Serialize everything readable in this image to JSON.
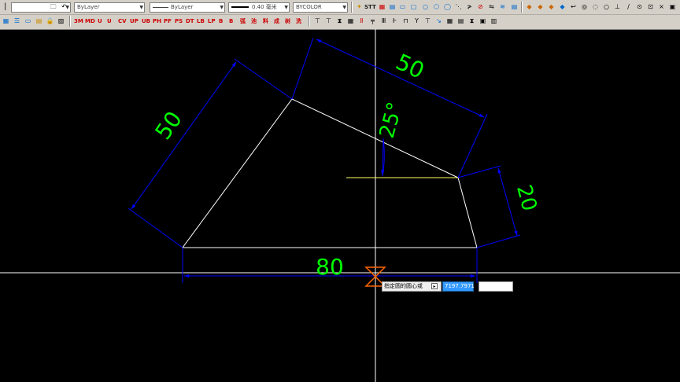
{
  "toolbar": {
    "layer_combo": "ByLayer",
    "linetype_combo": "ByLayer",
    "lineweight_combo": "0.40 毫米",
    "color_combo": "BYCOLOR",
    "row1_right_tools": [
      "STT"
    ],
    "row2_tools": [
      "3M",
      "MD",
      "U",
      "U",
      "CV",
      "UP",
      "UB",
      "PH",
      "PF",
      "PS",
      "DT",
      "LB",
      "LP",
      "B",
      "B",
      "弧",
      "池",
      "料",
      "成",
      "树",
      "洗"
    ]
  },
  "drawing": {
    "line_color": "#ffffff",
    "dimension_line_color": "#0000ff",
    "dimension_text_color": "#00ff00",
    "crosshair_color": "#ffffff",
    "snap_marker_color": "#ff6600",
    "dimensions": {
      "top_edge": "50",
      "left_edge": "50",
      "right_edge": "20",
      "bottom_edge": "80",
      "angle": "25°"
    }
  },
  "command_input": {
    "prompt": "指定圆的圆心或",
    "x_value": "7197.7971",
    "y_value": ""
  }
}
